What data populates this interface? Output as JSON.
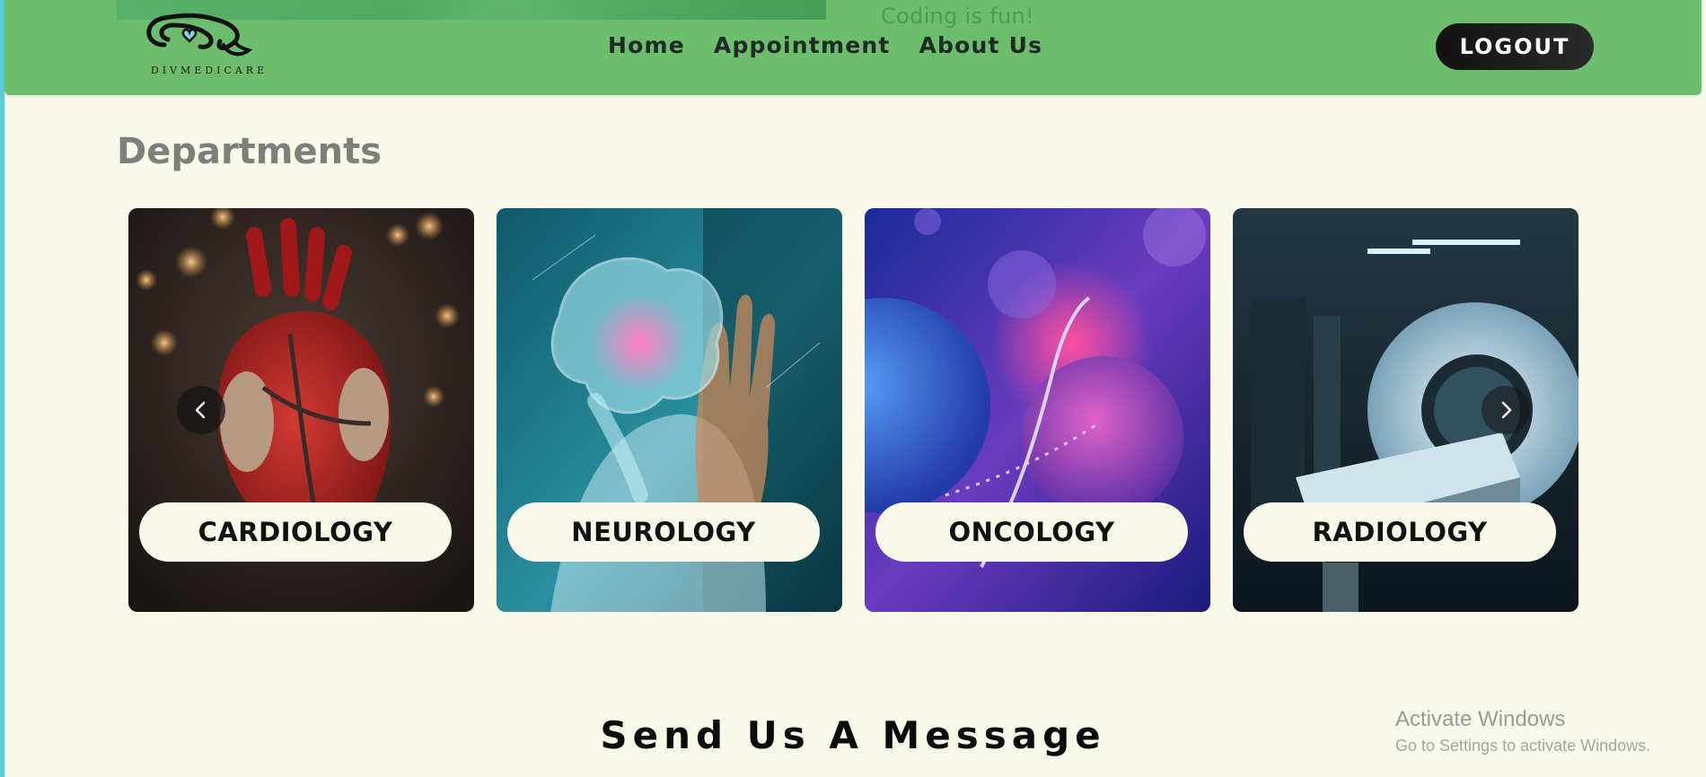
{
  "header": {
    "banner_text": "Coding is fun!",
    "logo_text": "DIVMEDICARE",
    "nav": [
      {
        "label": "Home"
      },
      {
        "label": "Appointment"
      },
      {
        "label": "About Us"
      }
    ],
    "logout_label": "LOGOUT",
    "colors": {
      "navbar": "#6cbd6c",
      "logout_bg": "#111111",
      "page_bg": "#f8f9e8"
    }
  },
  "departments": {
    "title": "Departments",
    "cards": [
      {
        "label": "CARDIOLOGY",
        "icon": "heart-image"
      },
      {
        "label": "NEUROLOGY",
        "icon": "brain-image"
      },
      {
        "label": "ONCOLOGY",
        "icon": "cell-image"
      },
      {
        "label": "RADIOLOGY",
        "icon": "mri-scanner-image"
      }
    ]
  },
  "contact": {
    "title": "Send Us A Message"
  },
  "watermark": {
    "title": "Activate Windows",
    "subtitle": "Go to Settings to activate Windows."
  }
}
